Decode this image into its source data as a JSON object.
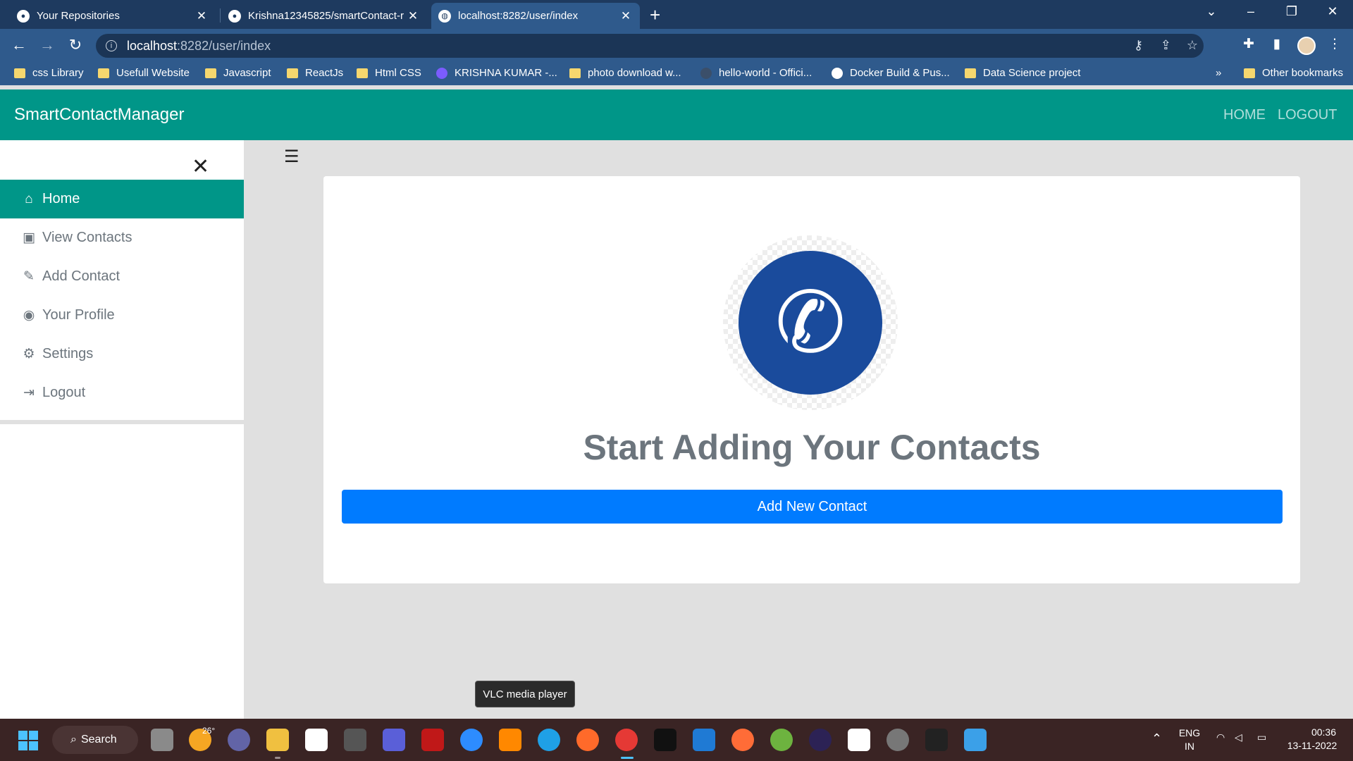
{
  "browser": {
    "tabs": [
      {
        "title": "Your Repositories",
        "active": false
      },
      {
        "title": "Krishna12345825/smartContact-r",
        "active": false
      },
      {
        "title": "localhost:8282/user/index",
        "active": true
      }
    ],
    "address": {
      "host": "localhost",
      "path": ":8282/user/index"
    },
    "bookmarks": [
      "css Library",
      "Usefull Website",
      "Javascript",
      "ReactJs",
      "Html CSS",
      "KRISHNA KUMAR -...",
      "photo download w...",
      "hello-world - Offici...",
      "Docker Build & Pus...",
      "Data Science project"
    ],
    "overflow": "»",
    "other_bookmarks": "Other bookmarks"
  },
  "navbar": {
    "brand": "SmartContactManager",
    "links": [
      "HOME",
      "LOGOUT"
    ]
  },
  "sidebar": {
    "items": [
      {
        "label": "Home",
        "icon": "home-icon",
        "active": true
      },
      {
        "label": "View Contacts",
        "icon": "contacts-icon",
        "active": false
      },
      {
        "label": "Add Contact",
        "icon": "pencil-icon",
        "active": false
      },
      {
        "label": "Your Profile",
        "icon": "user-circle-icon",
        "active": false
      },
      {
        "label": "Settings",
        "icon": "gears-icon",
        "active": false
      },
      {
        "label": "Logout",
        "icon": "sign-out-icon",
        "active": false
      }
    ]
  },
  "main": {
    "heading": "Start Adding Your Contacts",
    "button": "Add New Contact",
    "logo_icon": "phone-icon"
  },
  "tooltip": "VLC media player",
  "taskbar": {
    "search": "Search",
    "weather": "26°",
    "lang_top": "ENG",
    "lang_bottom": "IN",
    "time": "00:36",
    "date": "13-11-2022"
  },
  "colors": {
    "navbar": "#009688",
    "primary_button": "#007bff",
    "logo_blue": "#1a4b9c",
    "browser_frame": "#1e3a5f"
  }
}
